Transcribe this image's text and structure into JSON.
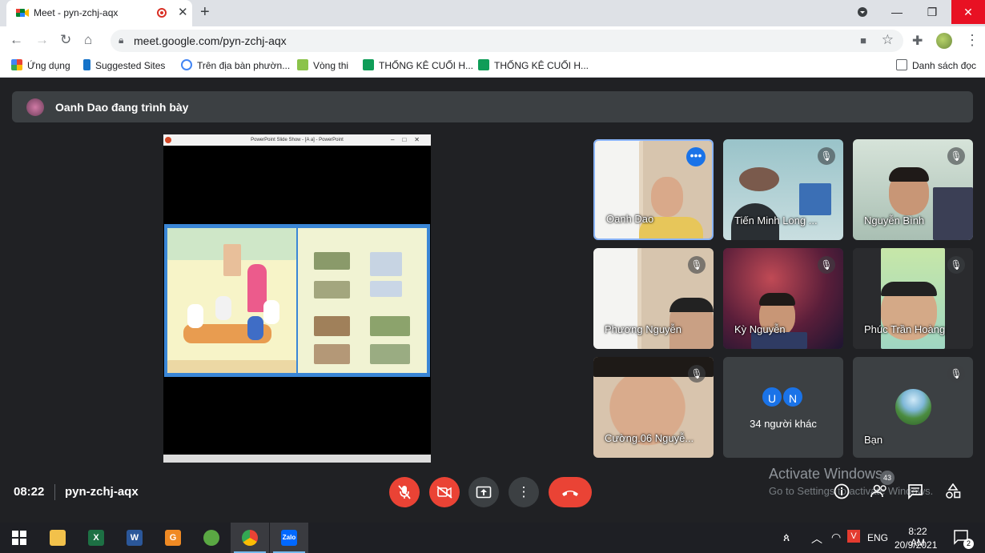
{
  "browser": {
    "tab_title": "Meet - pyn-zchj-aqx",
    "new_tab_symbol": "+",
    "url": "meet.google.com/pyn-zchj-aqx"
  },
  "bookmarks": {
    "items": [
      {
        "label": "Ứng dụng",
        "icon": "apps-grid-icon"
      },
      {
        "label": "Suggested Sites",
        "icon": "bing-icon"
      },
      {
        "label": "Trên địa bàn phườn...",
        "icon": "google-icon"
      },
      {
        "label": "Vòng thi",
        "icon": "sprout-icon"
      },
      {
        "label": "THỐNG KÊ CUỐI H...",
        "icon": "sheets-icon"
      },
      {
        "label": "THỐNG KÊ CUỐI H...",
        "icon": "sheets-icon"
      }
    ],
    "reading_list": "Danh sách đọc"
  },
  "meet": {
    "presenting_banner": "Oanh Dao đang trình bày",
    "presentation": {
      "window_title": "PowerPoint Slide Show - [A a] - PowerPoint"
    },
    "participants": [
      {
        "name": "Oanh Dao",
        "muted": false
      },
      {
        "name": "Tiến Minh Long ...",
        "muted": true
      },
      {
        "name": "Nguyễn Bình",
        "muted": true
      },
      {
        "name": "Phương Nguyễn",
        "muted": true
      },
      {
        "name": "Kỳ Nguyễn",
        "muted": true
      },
      {
        "name": "Phúc Trần Hoàng",
        "muted": true
      },
      {
        "name": "Cường.06 Nguyễ...",
        "muted": true
      }
    ],
    "others": {
      "initials": [
        "U",
        "N"
      ],
      "label": "34 người khác"
    },
    "self": {
      "name": "Bạn",
      "muted": true
    },
    "time": "08:22",
    "meeting_code": "pyn-zchj-aqx",
    "people_count": "43"
  },
  "watermark": {
    "line1": "Activate Windows",
    "line2": "Go to Settings to activate Windows."
  },
  "taskbar": {
    "language": "ENG",
    "time": "8:22 AM",
    "date": "20/9/2021",
    "notification_count": "2",
    "apps": [
      "windows-start",
      "file-explorer",
      "excel",
      "word",
      "foxit-reader",
      "coc-coc",
      "chrome",
      "zalo"
    ]
  },
  "colors": {
    "meet_bg": "#202124",
    "tile_bg": "#3c4043",
    "danger": "#ea4335",
    "accent": "#1a73e8"
  }
}
